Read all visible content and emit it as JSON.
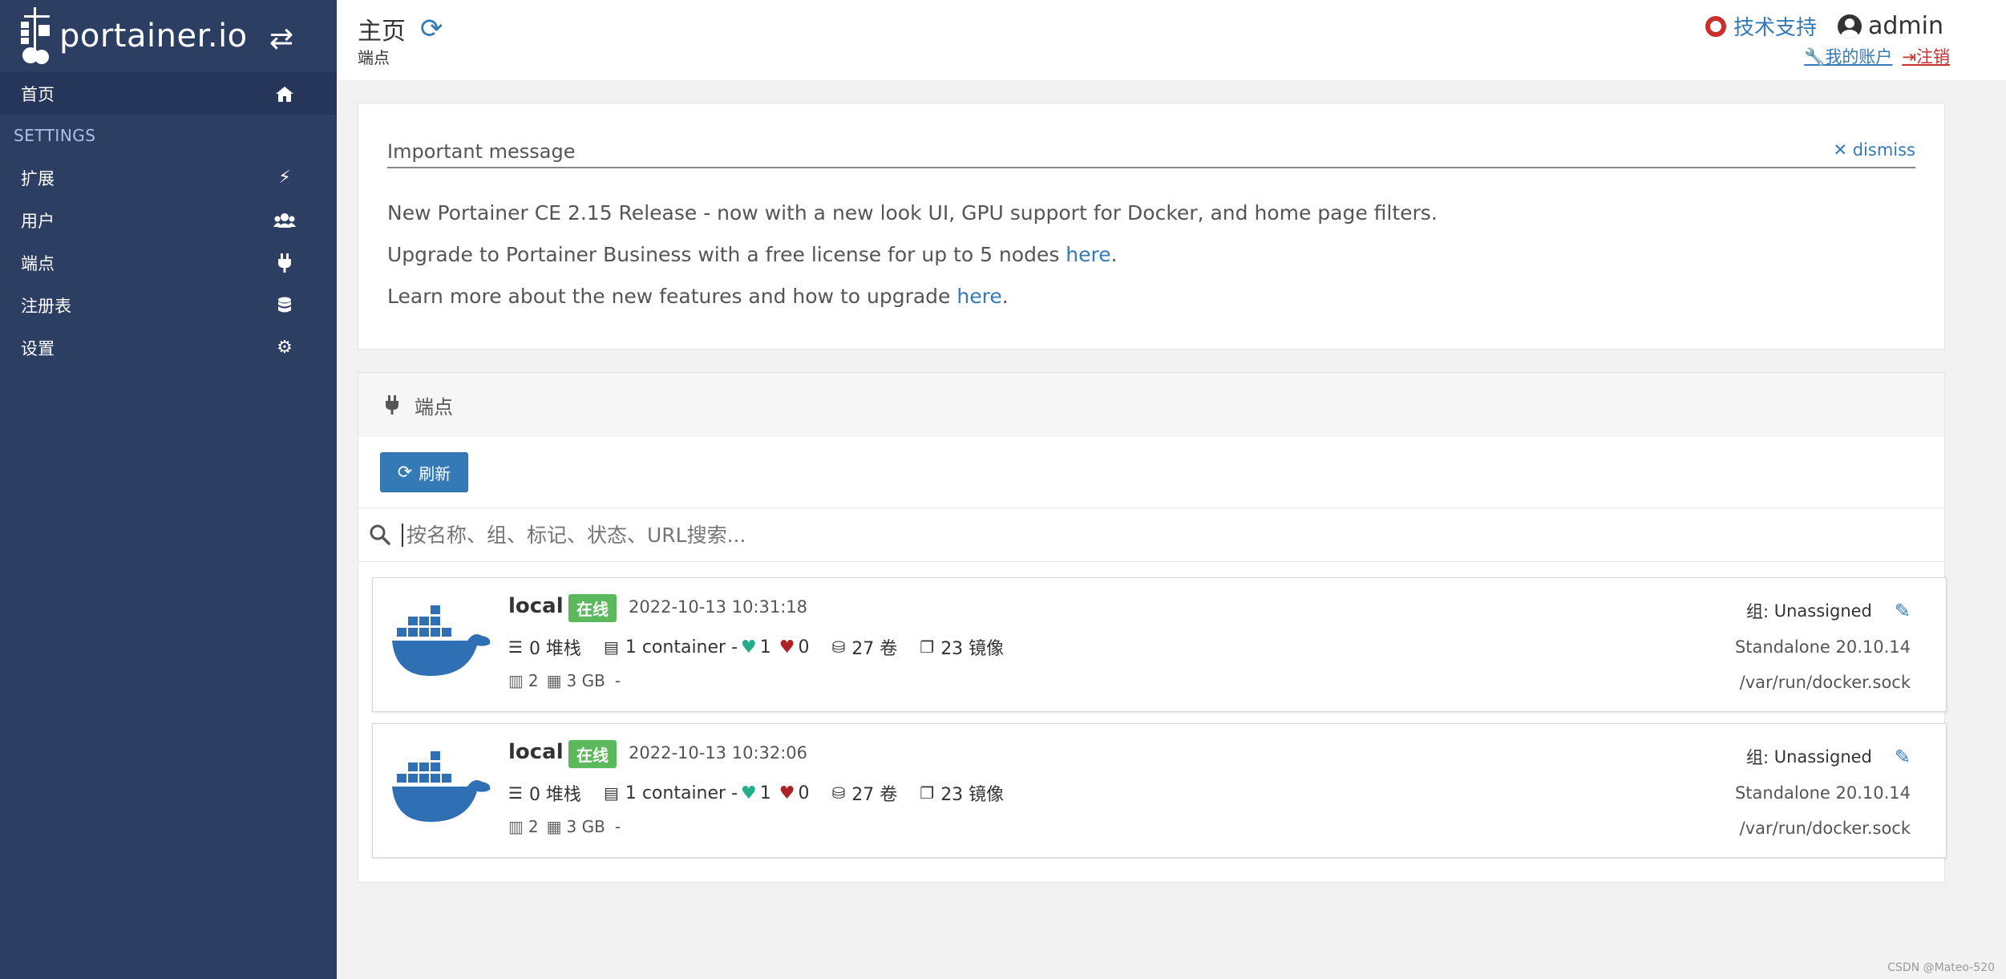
{
  "sidebar": {
    "brand": "portainer.io",
    "items": [
      {
        "label": "首页",
        "icon": "home-icon"
      },
      {
        "label": "扩展",
        "icon": "bolt-icon"
      },
      {
        "label": "用户",
        "icon": "users-icon"
      },
      {
        "label": "端点",
        "icon": "plug-icon"
      },
      {
        "label": "注册表",
        "icon": "database-icon"
      },
      {
        "label": "设置",
        "icon": "cogs-icon"
      }
    ],
    "section_label": "SETTINGS"
  },
  "header": {
    "title": "主页",
    "breadcrumb": "端点",
    "support_label": "技术支持",
    "username": "admin",
    "account_label": "我的账户",
    "logout_label": "注销"
  },
  "message": {
    "title": "Important message",
    "dismiss_label": "dismiss",
    "line1": "New Portainer CE 2.15 Release - now with a new look UI, GPU support for Docker, and home page filters.",
    "line2_text": "Upgrade to Portainer Business with a free license for up to 5 nodes ",
    "line2_link": "here",
    "line3_text": "Learn more about the new features and how to upgrade ",
    "line3_link": "here",
    "period": "."
  },
  "endpoints": {
    "panel_title": "端点",
    "refresh_label": "刷新",
    "search_placeholder": "按名称、组、标记、状态、URL搜索...",
    "items": [
      {
        "name": "local",
        "status": "在线",
        "timestamp": "2022-10-13 10:31:18",
        "stacks": "0 堆栈",
        "containers": "1 container -",
        "healthy": "1",
        "unhealthy": "0",
        "volumes": "27 卷",
        "images": "23 镜像",
        "cpu": "2",
        "memory": "3 GB",
        "dash": "-",
        "group_label": "组:",
        "group": "Unassigned",
        "type": "Standalone 20.10.14",
        "url": "/var/run/docker.sock"
      },
      {
        "name": "local",
        "status": "在线",
        "timestamp": "2022-10-13 10:32:06",
        "stacks": "0 堆栈",
        "containers": "1 container -",
        "healthy": "1",
        "unhealthy": "0",
        "volumes": "27 卷",
        "images": "23 镜像",
        "cpu": "2",
        "memory": "3 GB",
        "dash": "-",
        "group_label": "组:",
        "group": "Unassigned",
        "type": "Standalone 20.10.14",
        "url": "/var/run/docker.sock"
      }
    ]
  },
  "watermark": "CSDN @Mateo-520",
  "colors": {
    "sidebar_bg": "#2d3e63",
    "primary": "#337ab7",
    "online": "#5cb85c",
    "danger": "#c9302c"
  }
}
